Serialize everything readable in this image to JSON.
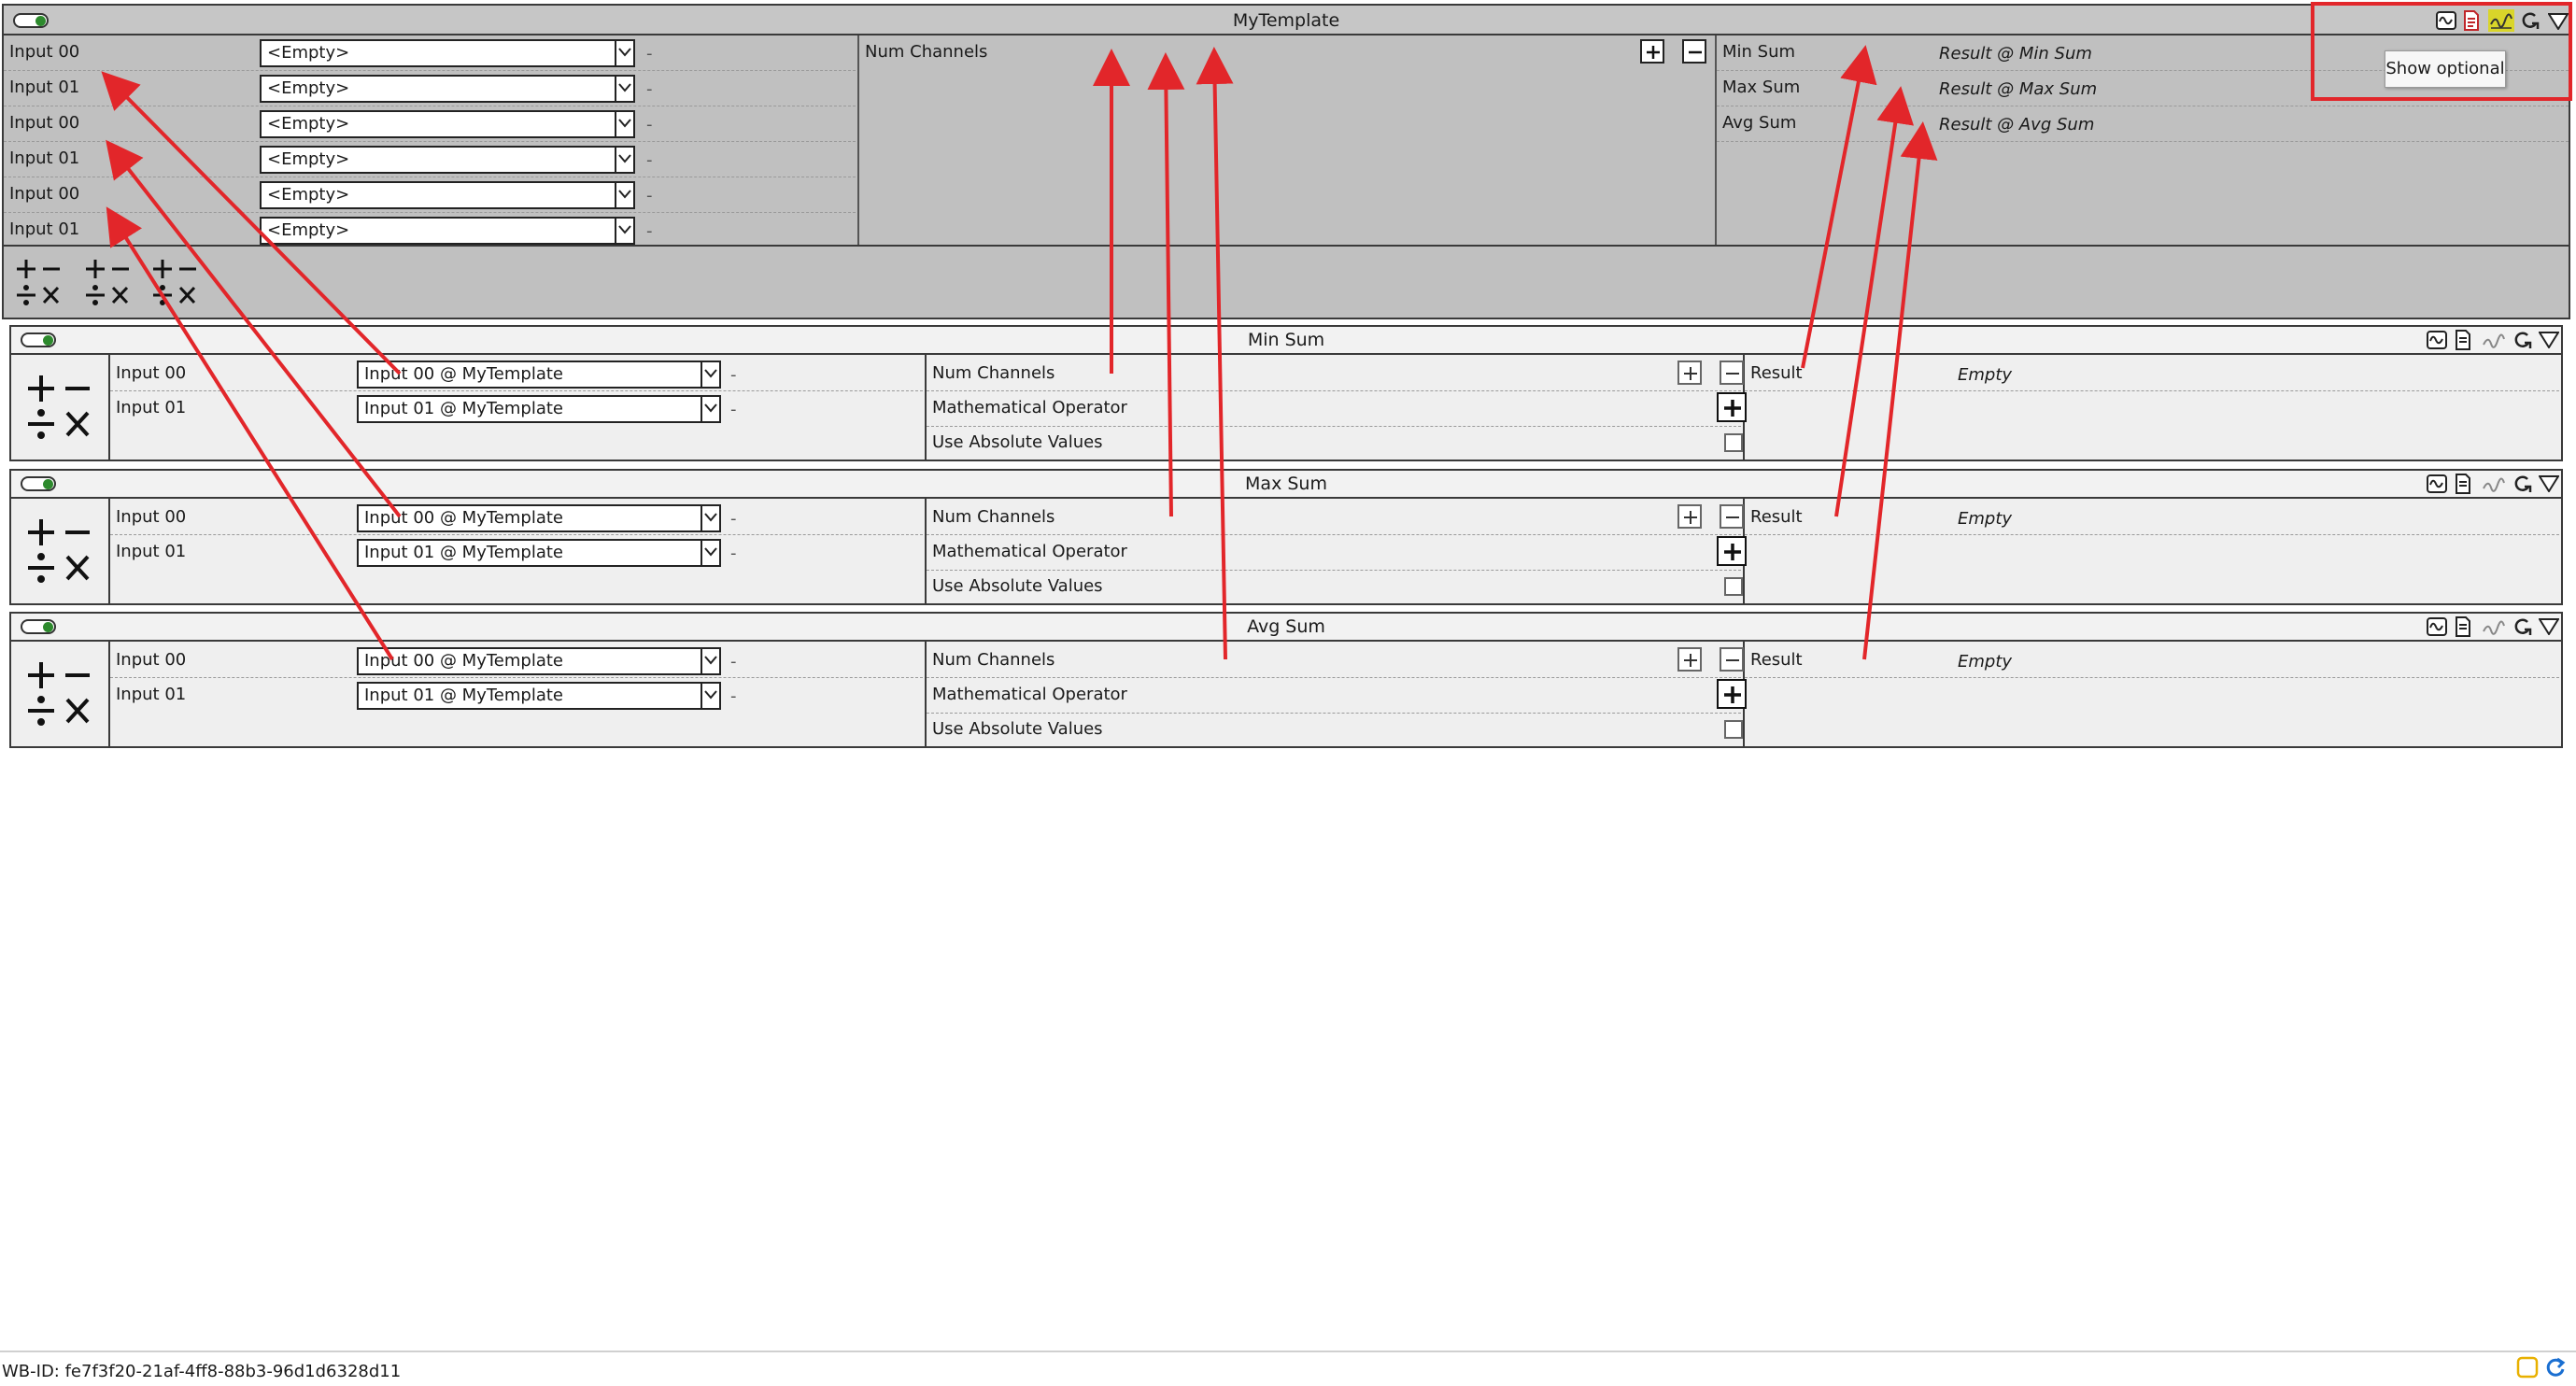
{
  "template": {
    "title": "MyTemplate",
    "inputs": [
      {
        "label": "Input 00",
        "value": "<Empty>",
        "dash": "-"
      },
      {
        "label": "Input 01",
        "value": "<Empty>",
        "dash": "-"
      },
      {
        "label": "Input 00",
        "value": "<Empty>",
        "dash": "-"
      },
      {
        "label": "Input 01",
        "value": "<Empty>",
        "dash": "-"
      },
      {
        "label": "Input 00",
        "value": "<Empty>",
        "dash": "-"
      },
      {
        "label": "Input 01",
        "value": "<Empty>",
        "dash": "-"
      }
    ],
    "num_channels_label": "Num Channels",
    "outputs": [
      {
        "label": "Min Sum",
        "value": "Result @ Min Sum"
      },
      {
        "label": "Max Sum",
        "value": "Result @ Max Sum"
      },
      {
        "label": "Avg Sum",
        "value": "Result @ Avg Sum"
      }
    ],
    "show_optional_tooltip": "Show optional"
  },
  "nodes": [
    {
      "title": "Min Sum",
      "inputs": [
        {
          "label": "Input 00",
          "value": "Input 00 @ MyTemplate",
          "dash": "-"
        },
        {
          "label": "Input 01",
          "value": "Input 01 @ MyTemplate",
          "dash": "-"
        }
      ],
      "params": {
        "num_channels": "Num Channels",
        "operator": "Mathematical Operator",
        "absolute": "Use Absolute Values"
      },
      "output": {
        "label": "Result",
        "value": "Empty"
      }
    },
    {
      "title": "Max Sum",
      "inputs": [
        {
          "label": "Input 00",
          "value": "Input 00 @ MyTemplate",
          "dash": "-"
        },
        {
          "label": "Input 01",
          "value": "Input 01 @ MyTemplate",
          "dash": "-"
        }
      ],
      "params": {
        "num_channels": "Num Channels",
        "operator": "Mathematical Operator",
        "absolute": "Use Absolute Values"
      },
      "output": {
        "label": "Result",
        "value": "Empty"
      }
    },
    {
      "title": "Avg Sum",
      "inputs": [
        {
          "label": "Input 00",
          "value": "Input 00 @ MyTemplate",
          "dash": "-"
        },
        {
          "label": "Input 01",
          "value": "Input 01 @ MyTemplate",
          "dash": "-"
        }
      ],
      "params": {
        "num_channels": "Num Channels",
        "operator": "Mathematical Operator",
        "absolute": "Use Absolute Values"
      },
      "output": {
        "label": "Result",
        "value": "Empty"
      }
    }
  ],
  "status": {
    "wb_id": "WB-ID: fe7f3f20-21af-4ff8-88b3-96d1d6328d11"
  },
  "colors": {
    "annotation_red": "#e2262a",
    "toggle_green": "#2d8a2d",
    "panel_gray": "#c0c0c0",
    "highlight_yellow": "#e8e020"
  }
}
